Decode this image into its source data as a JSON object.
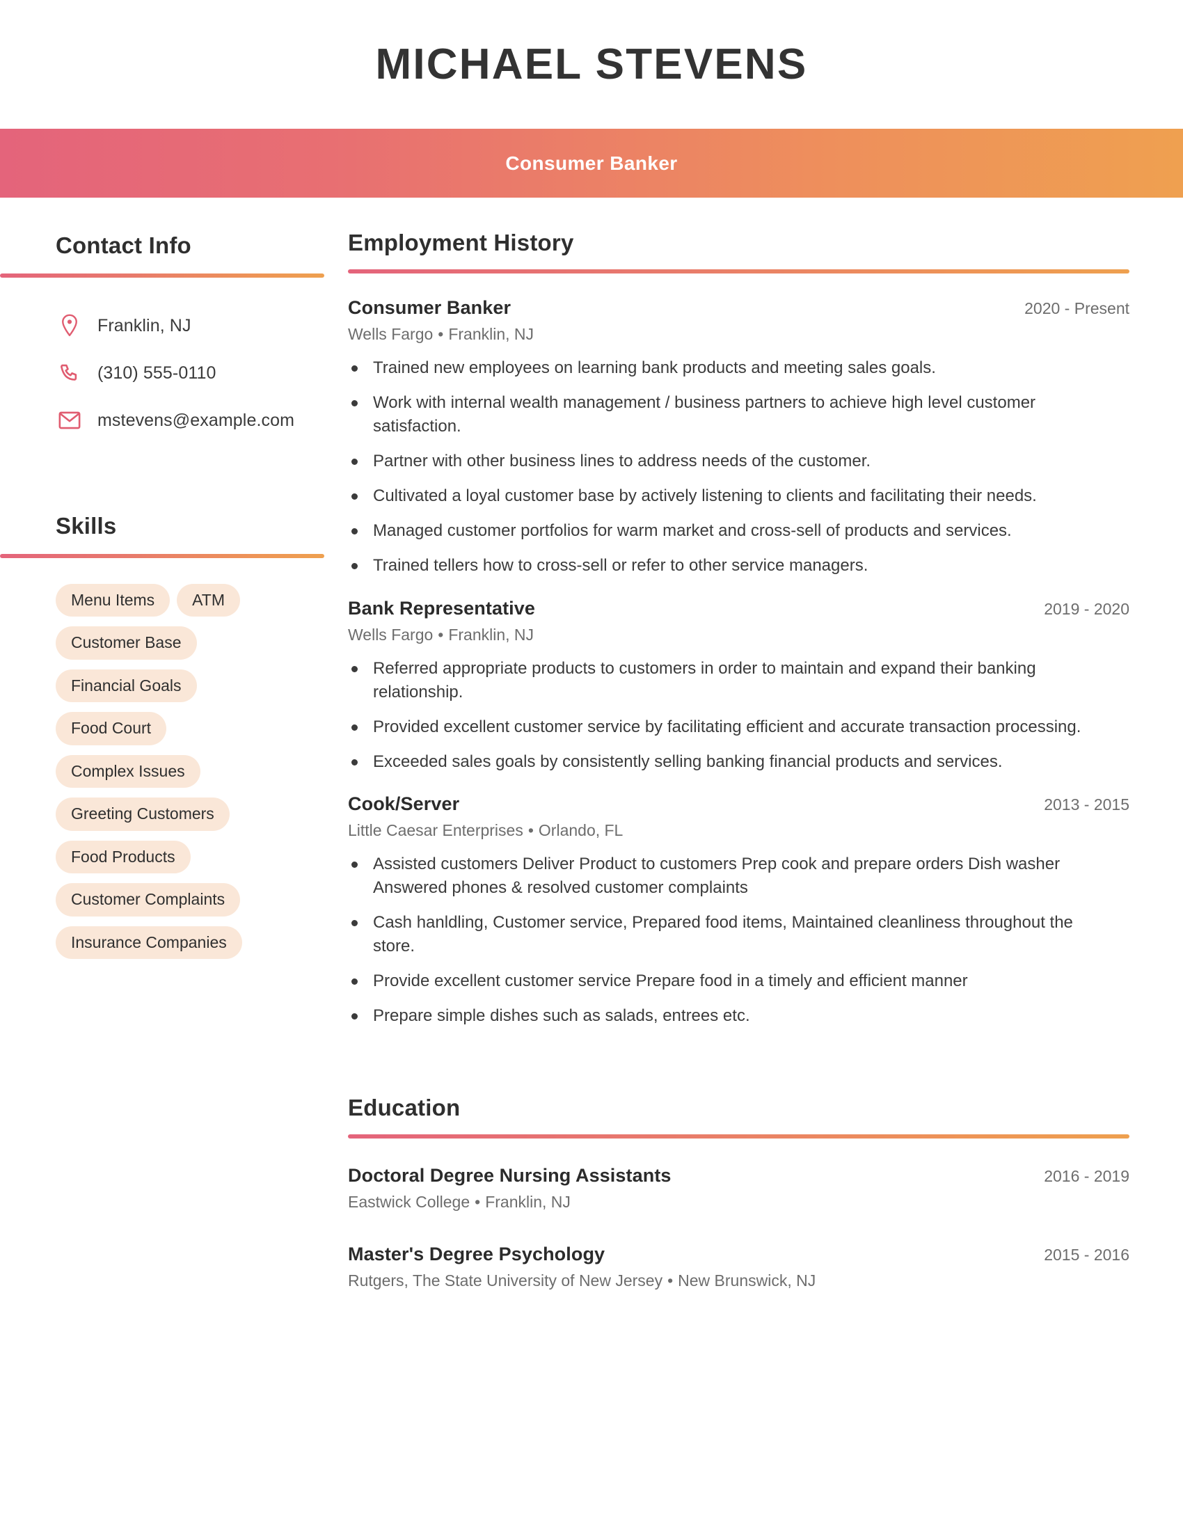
{
  "theme": {
    "accent_start": "#e4647b",
    "accent_end": "#efa050",
    "pill_background": "#fae7d8",
    "icon_color": "#e05c70",
    "heading_color": "#2f2f2f",
    "muted_text": "#6d6d6d"
  },
  "header": {
    "full_name": "MICHAEL STEVENS",
    "job_title": "Consumer Banker"
  },
  "sidebar": {
    "contact": {
      "heading": "Contact Info",
      "items": [
        {
          "icon": "location-pin-icon",
          "value": "Franklin, NJ"
        },
        {
          "icon": "phone-icon",
          "value": "(310) 555-0110"
        },
        {
          "icon": "envelope-icon",
          "value": "mstevens@example.com"
        }
      ]
    },
    "skills": {
      "heading": "Skills",
      "items": [
        "Menu Items",
        "ATM",
        "Customer Base",
        "Financial Goals",
        "Food Court",
        "Complex Issues",
        "Greeting Customers",
        "Food Products",
        "Customer Complaints",
        "Insurance Companies"
      ]
    }
  },
  "main": {
    "employment": {
      "heading": "Employment History",
      "entries": [
        {
          "title": "Consumer Banker",
          "dates": "2020 - Present",
          "company": "Wells Fargo",
          "separator": "•",
          "location": "Franklin, NJ",
          "bullets": [
            "Trained new employees on learning bank products and meeting sales goals.",
            "Work with internal wealth management / business partners to achieve high level customer satisfaction.",
            "Partner with other business lines to address needs of the customer.",
            "Cultivated a loyal customer base by actively listening to clients and facilitating their needs.",
            "Managed customer portfolios for warm market and cross-sell of products and services.",
            "Trained tellers how to cross-sell or refer to other service managers."
          ]
        },
        {
          "title": "Bank Representative",
          "dates": "2019 - 2020",
          "company": "Wells Fargo",
          "separator": "•",
          "location": "Franklin, NJ",
          "bullets": [
            "Referred appropriate products to customers in order to maintain and expand their banking relationship.",
            "Provided excellent customer service by facilitating efficient and accurate transaction processing.",
            "Exceeded sales goals by consistently selling banking financial products and services."
          ]
        },
        {
          "title": "Cook/Server",
          "dates": "2013 - 2015",
          "company": "Little Caesar Enterprises",
          "separator": "•",
          "location": "Orlando, FL",
          "bullets": [
            "Assisted customers Deliver Product to customers Prep cook and prepare orders Dish washer Answered phones & resolved customer complaints",
            "Cash hanldling, Customer service, Prepared food items, Maintained cleanliness throughout the store.",
            "Provide excellent customer service Prepare food in a timely and efficient manner",
            "Prepare simple dishes such as salads, entrees etc."
          ]
        }
      ]
    },
    "education": {
      "heading": "Education",
      "entries": [
        {
          "degree": "Doctoral Degree Nursing Assistants",
          "dates": "2016 - 2019",
          "school": "Eastwick College",
          "separator": "•",
          "location": "Franklin, NJ"
        },
        {
          "degree": "Master's Degree Psychology",
          "dates": "2015 - 2016",
          "school": "Rutgers, The State University of New Jersey",
          "separator": "•",
          "location": "New Brunswick, NJ"
        }
      ]
    }
  }
}
